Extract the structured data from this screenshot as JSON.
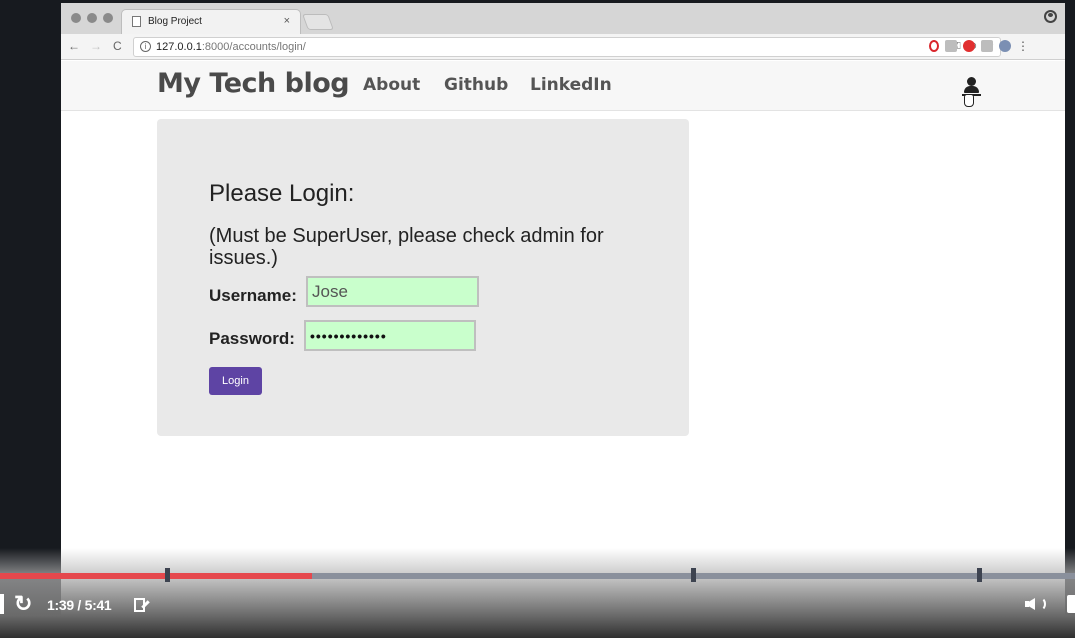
{
  "browser": {
    "tab_title": "Blog Project",
    "tab_close": "×",
    "url_host": "127.0.0.1",
    "url_rest": ":8000/accounts/login/",
    "nav_back": "←",
    "nav_forward": "→",
    "nav_reload": "C"
  },
  "site": {
    "brand": "My Tech blog",
    "nav_links": [
      "About",
      "Github",
      "LinkedIn"
    ]
  },
  "login": {
    "heading": "Please Login:",
    "note": "(Must be SuperUser, please check admin for issues.)",
    "username_label": "Username:",
    "username_value": "Jose",
    "password_label": "Password:",
    "password_value": "•••••••••••••",
    "button_label": "Login",
    "input_bg": "#c9ffcc",
    "button_bg": "#5e44a4"
  },
  "player": {
    "time": "1:39 / 5:41",
    "progress_fraction": 0.29,
    "progress_color": "#e5484d",
    "icons": [
      "replay-icon",
      "notes-icon",
      "volume-icon"
    ]
  }
}
